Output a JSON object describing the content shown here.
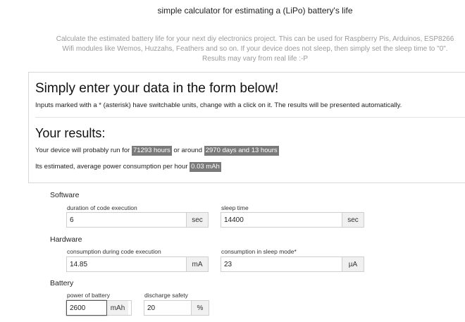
{
  "header": {
    "title": "simple calculator for estimating a (LiPo) battery's life",
    "intro": "Calculate the estimated battery life for your next diy electronics project. This can be used for Raspberry Pis, Arduinos, ESP8266 Wifi modules like Wemos, Huzzahs, Feathers and so on. If your device does not sleep, then simply set the sleep time to \"0\". Results may vary from real life :-P"
  },
  "form_intro": {
    "heading": "Simply enter your data in the form below!",
    "hint": "Inputs marked with a * (asterisk) have switchable units, change with a click on it. The results will be presented automatically."
  },
  "results": {
    "heading": "Your results:",
    "run_prefix": "Your device will probably run for",
    "run_hours": "71293 hours",
    "run_middle": "or around",
    "run_days": "2970 days and 13 hours",
    "consumption_prefix": "Its estimated, average power consumption per hour",
    "consumption_value": "0.03 mAh"
  },
  "software": {
    "title": "Software",
    "code_duration": {
      "label": "duration of code execution",
      "value": "6",
      "unit": "sec"
    },
    "sleep_time": {
      "label": "sleep time",
      "value": "14400",
      "unit": "sec"
    }
  },
  "hardware": {
    "title": "Hardware",
    "code_consumption": {
      "label": "consumption during code execution",
      "value": "14.85",
      "unit": "mA"
    },
    "sleep_consumption": {
      "label": "consumption in sleep mode*",
      "value": "23",
      "unit": "µA"
    }
  },
  "battery": {
    "title": "Battery",
    "capacity": {
      "label": "power of battery",
      "value": "2600",
      "unit": "mAh"
    },
    "discharge_safety": {
      "label": "discharge safety",
      "value": "20",
      "unit": "%"
    }
  }
}
